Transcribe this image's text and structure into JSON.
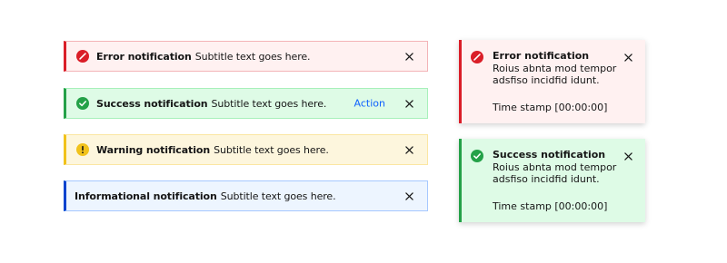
{
  "inline": {
    "error": {
      "title": "Error notification",
      "subtitle": "Subtitle text goes here.",
      "icon": "error-icon",
      "accent": "#da1e28",
      "background": "#fff1f1"
    },
    "success": {
      "title": "Success notification",
      "subtitle": "Subtitle text goes here.",
      "action": "Action",
      "icon": "checkmark-icon",
      "accent": "#24a148",
      "background": "#defbe6"
    },
    "warning": {
      "title": "Warning notification",
      "subtitle": "Subtitle text goes here.",
      "icon": "warning-icon",
      "accent": "#f1c21b",
      "background": "#fdf6dd"
    },
    "info": {
      "title": "Informational notification",
      "subtitle": "Subtitle text goes here.",
      "accent": "#0043ce",
      "background": "#edf5ff"
    }
  },
  "toasts": {
    "error": {
      "title": "Error notification",
      "subtitle": "Roius abnta mod tempor adsfiso incidfid idunt.",
      "timestamp": "Time stamp [00:00:00]",
      "icon": "error-icon",
      "accent": "#da1e28"
    },
    "success": {
      "title": "Success notification",
      "subtitle": "Roius abnta mod tempor adsfiso incidfid idunt.",
      "timestamp": "Time stamp [00:00:00]",
      "icon": "checkmark-icon",
      "accent": "#24a148"
    }
  },
  "close_icon": "close-icon",
  "action_color": "#0f62fe"
}
